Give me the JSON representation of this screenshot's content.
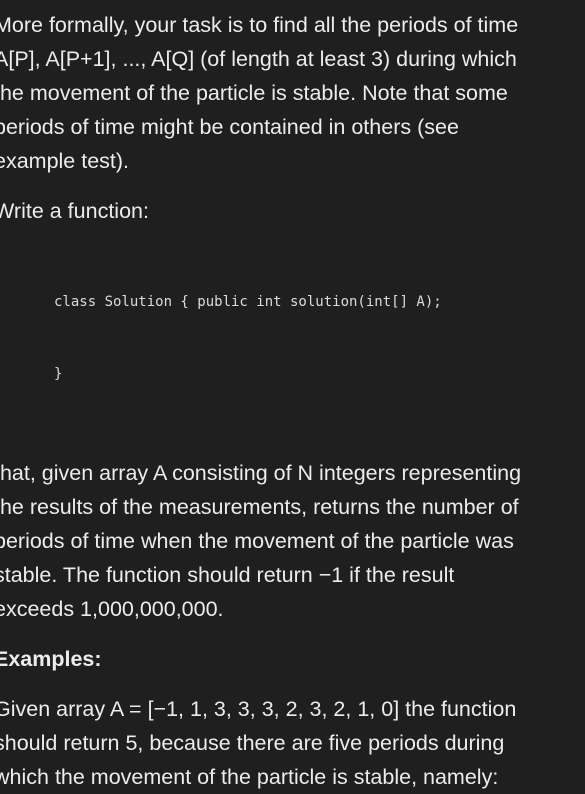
{
  "intro": {
    "lines": [
      "More formally, your task is to find all the periods of time",
      "A[P], A[P+1], ..., A[Q] (of length at least 3) during which",
      "the movement of the particle is stable. Note that some",
      "periods of time might be contained in others (see",
      "example test)."
    ]
  },
  "write_function": "Write a function:",
  "code": {
    "lines": [
      "class Solution { public int solution(int[] A);",
      "}"
    ]
  },
  "description": {
    "lines": [
      "that, given array A consisting of N integers representing",
      "the results of the measurements, returns the number of",
      "periods of time when the movement of the particle was",
      "stable. The function should return −1 if the result",
      "exceeds 1,000,000,000."
    ]
  },
  "examples_heading": "Examples:",
  "example": {
    "lines": [
      "Given array A = [−1, 1, 3, 3, 3, 2, 3, 2, 1, 0] the function",
      "should return 5, because there are five periods during",
      "which the movement of the particle is stable, namely:"
    ]
  }
}
